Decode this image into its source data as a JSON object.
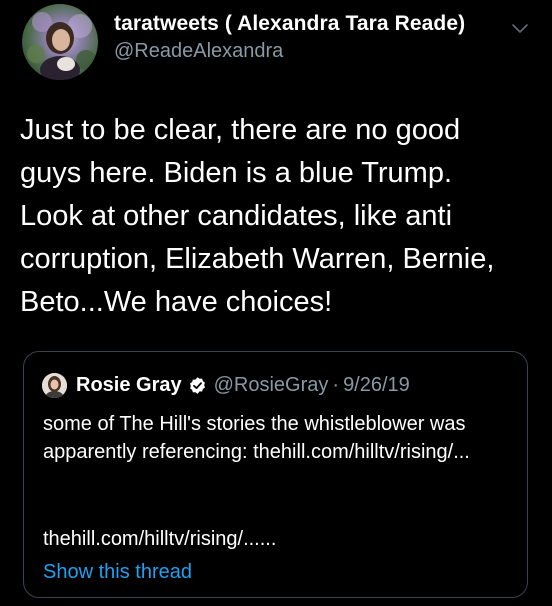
{
  "tweet": {
    "author_name": "taratweets ( Alexandra Tara Reade)",
    "author_handle": "@ReadeAlexandra",
    "menu_icon": "chevron-down-icon",
    "text": "Just to be clear, there are no good\nguys here. Biden is a blue Trump.\nLook at other candidates, like anti\ncorruption, Elizabeth Warren, Bernie,\nBeto...We have choices!"
  },
  "quoted_tweet": {
    "author_name": "Rosie Gray",
    "verified_icon": "verified-badge-icon",
    "author_handle": "@RosieGray",
    "separator": "·",
    "date": "9/26/19",
    "text": "some of The Hill's stories the whistleblower was apparently referencing: thehill.com/hilltv/rising/...",
    "link_text": "thehill.com/hilltv/rising/......",
    "show_thread_label": "Show this thread"
  },
  "colors": {
    "background": "#000000",
    "text_primary": "#ffffff",
    "text_secondary": "#8899a6",
    "link": "#1da1f2",
    "verified": "#ffffff",
    "border": "#38444d"
  }
}
